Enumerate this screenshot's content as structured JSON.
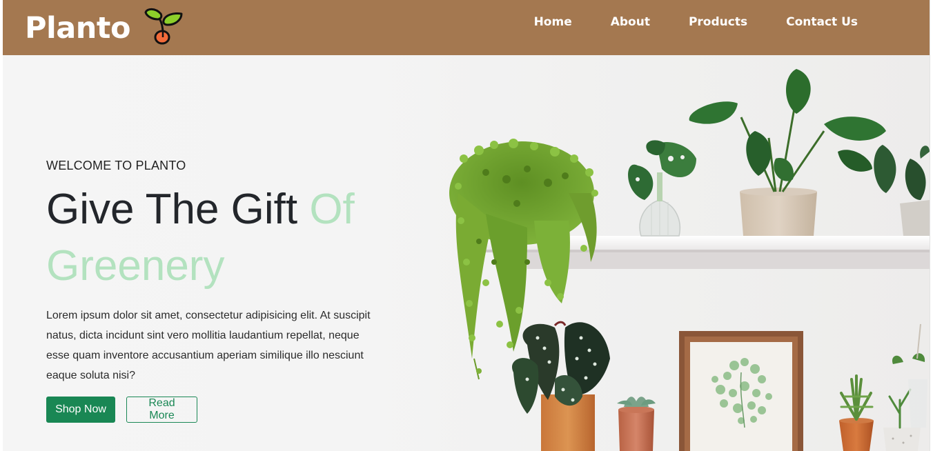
{
  "brand": {
    "name": "Planto",
    "logo_icon": "sprout-icon"
  },
  "nav": {
    "items": [
      {
        "label": "Home"
      },
      {
        "label": "About"
      },
      {
        "label": "Products"
      },
      {
        "label": "Contact Us"
      }
    ]
  },
  "hero": {
    "eyebrow": "WELCOME TO PLANTO",
    "headline_part1": "Give The Gift ",
    "headline_accent1": "Of",
    "headline_accent2": "Greenery",
    "body": "Lorem ipsum dolor sit amet, consectetur adipisicing elit. At suscipit natus, dicta incidunt sint vero mollitia laudantium repellat, neque esse quam inventore accusantium aperiam similique illo nesciunt eaque soluta nisi?",
    "primary_button": "Shop Now",
    "secondary_button": "Read More"
  },
  "colors": {
    "navbar": "#a47850",
    "accent_green": "#b3e2bf",
    "button_green": "#198754"
  }
}
